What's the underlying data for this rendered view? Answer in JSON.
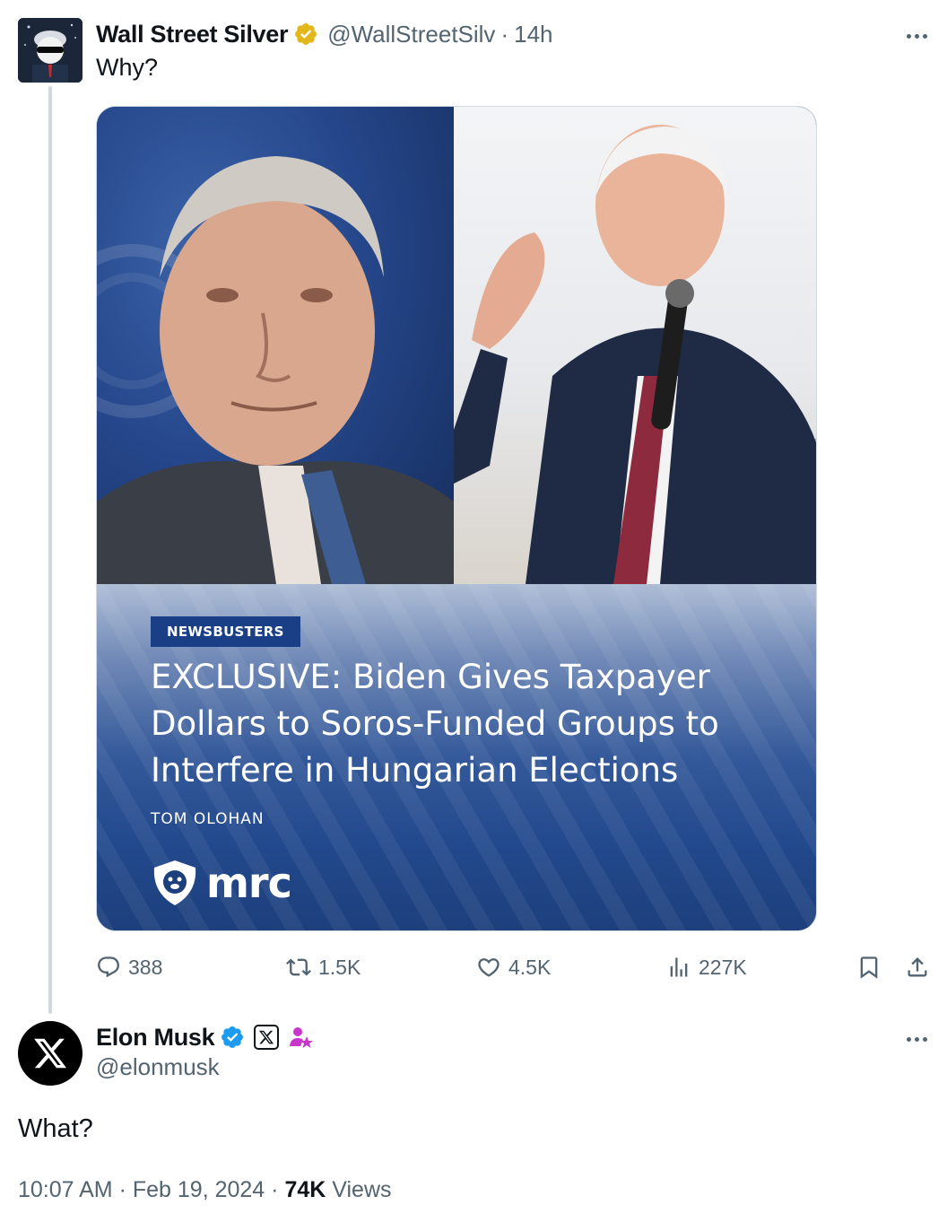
{
  "tweet1": {
    "display_name": "Wall Street Silver",
    "handle": "@WallStreetSilv",
    "separator": "·",
    "time_ago": "14h",
    "text": "Why?",
    "verified_badge": "gold-verified-icon",
    "media": {
      "tag": "NEWSBUSTERS",
      "headline": "EXCLUSIVE: Biden Gives Taxpayer Dollars to Soros-Funded Groups to Interfere in Hungarian Elections",
      "author": "TOM OLOHAN",
      "logo_text": "mrc"
    },
    "actions": {
      "replies": "388",
      "retweets": "1.5K",
      "likes": "4.5K",
      "views": "227K"
    }
  },
  "tweet2": {
    "display_name": "Elon Musk",
    "handle": "@elonmusk",
    "text": "What?",
    "time": "10:07 AM",
    "separator": "·",
    "date": "Feb 19, 2024",
    "views_count": "74K",
    "views_label": "Views"
  },
  "colors": {
    "text_primary": "#0f1419",
    "text_secondary": "#536471",
    "verified_blue": "#1d9bf0",
    "verified_gold": "#e2b719",
    "thread_line": "#cfd9de",
    "subscriber_pink": "#c936cc"
  }
}
